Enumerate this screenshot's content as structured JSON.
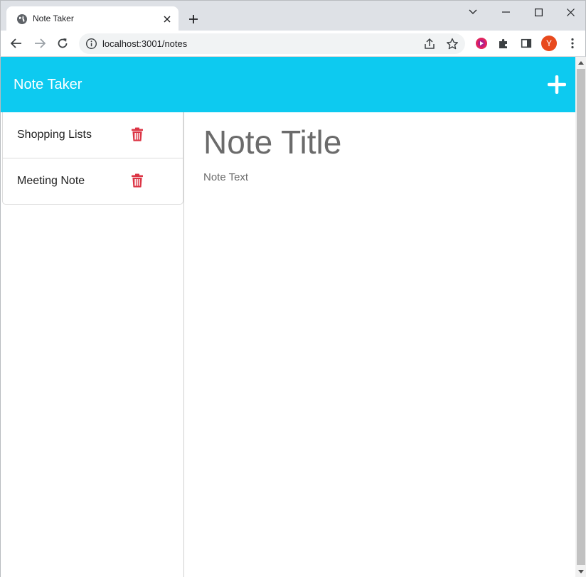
{
  "browser": {
    "tab_title": "Note Taker",
    "url": "localhost:3001/notes",
    "profile_initial": "Y"
  },
  "app": {
    "brand": "Note Taker",
    "accent_color": "#0dcaf0",
    "delete_color": "#dc3545"
  },
  "notes": [
    {
      "title": "Shopping Lists"
    },
    {
      "title": "Meeting Note"
    }
  ],
  "editor": {
    "title_placeholder": "Note Title",
    "text_placeholder": "Note Text"
  }
}
